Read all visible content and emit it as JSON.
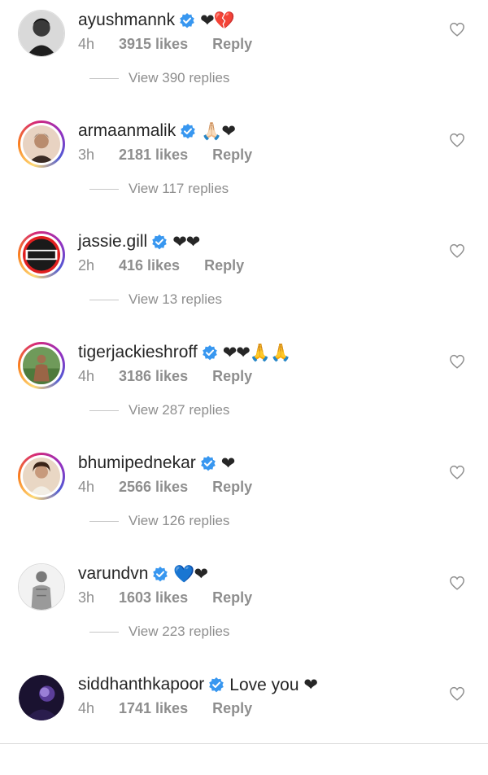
{
  "colors": {
    "verified": "#3897f0",
    "heart": "#ed4956",
    "muted": "#8e8e8e",
    "username": "#262626"
  },
  "comments": [
    {
      "username": "ayushmannk",
      "text": "❤💔",
      "time": "4h",
      "likes": "3915 likes",
      "reply": "Reply",
      "view_replies": "View 390 replies",
      "verified": true
    },
    {
      "username": "armaanmalik",
      "text": "🙏🏻❤",
      "time": "3h",
      "likes": "2181 likes",
      "reply": "Reply",
      "view_replies": "View 117 replies",
      "verified": true
    },
    {
      "username": "jassie.gill",
      "text": "❤❤",
      "time": "2h",
      "likes": "416 likes",
      "reply": "Reply",
      "view_replies": "View 13 replies",
      "verified": true
    },
    {
      "username": "tigerjackieshroff",
      "text": "❤❤🙏🙏",
      "time": "4h",
      "likes": "3186 likes",
      "reply": "Reply",
      "view_replies": "View 287 replies",
      "verified": true
    },
    {
      "username": "bhumipednekar",
      "text": "❤",
      "time": "4h",
      "likes": "2566 likes",
      "reply": "Reply",
      "view_replies": "View 126 replies",
      "verified": true
    },
    {
      "username": "varundvn",
      "text": "💙❤",
      "time": "3h",
      "likes": "1603 likes",
      "reply": "Reply",
      "view_replies": "View 223 replies",
      "verified": true
    },
    {
      "username": "siddhanthkapoor",
      "text": "Love you ❤",
      "time": "4h",
      "likes": "1741 likes",
      "reply": "Reply",
      "verified": true
    }
  ]
}
